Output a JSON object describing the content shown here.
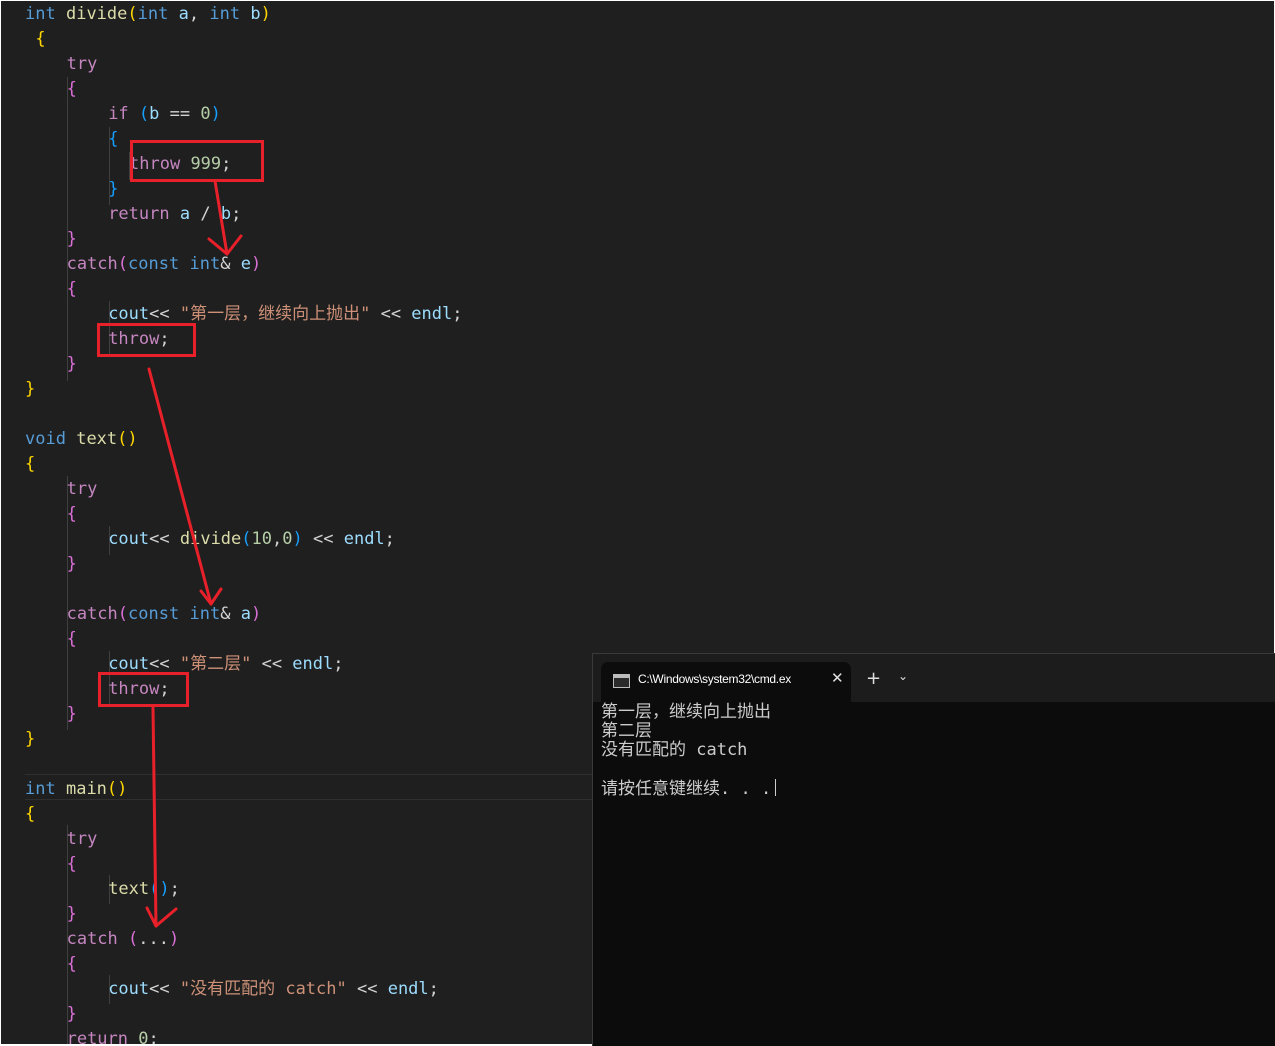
{
  "editor": {
    "lines": [
      {
        "indent": 0,
        "tokens": [
          {
            "t": "int",
            "c": "kw"
          },
          {
            "t": " "
          },
          {
            "t": "divide",
            "c": "fn"
          },
          {
            "t": "(",
            "c": "b1"
          },
          {
            "t": "int",
            "c": "kw"
          },
          {
            "t": " "
          },
          {
            "t": "a",
            "c": "var"
          },
          {
            "t": ", ",
            "c": "pl"
          },
          {
            "t": "int",
            "c": "kw"
          },
          {
            "t": " "
          },
          {
            "t": "b",
            "c": "var"
          },
          {
            "t": ")",
            "c": "b1"
          }
        ]
      },
      {
        "indent": 1,
        "tokens": [
          {
            "t": "{",
            "c": "b1"
          }
        ]
      },
      {
        "indent": 4,
        "tokens": [
          {
            "t": "try",
            "c": "ctl"
          }
        ]
      },
      {
        "indent": 4,
        "tokens": [
          {
            "t": "{",
            "c": "b2"
          }
        ]
      },
      {
        "indent": 8,
        "tokens": [
          {
            "t": "if",
            "c": "ctl"
          },
          {
            "t": " "
          },
          {
            "t": "(",
            "c": "b3"
          },
          {
            "t": "b",
            "c": "var"
          },
          {
            "t": " == ",
            "c": "pl"
          },
          {
            "t": "0",
            "c": "num"
          },
          {
            "t": ")",
            "c": "b3"
          }
        ]
      },
      {
        "indent": 8,
        "tokens": [
          {
            "t": "{",
            "c": "b3"
          }
        ]
      },
      {
        "indent": 10,
        "tokens": [
          {
            "t": "throw",
            "c": "ctl"
          },
          {
            "t": " "
          },
          {
            "t": "999",
            "c": "num"
          },
          {
            "t": ";",
            "c": "pl"
          }
        ]
      },
      {
        "indent": 8,
        "tokens": [
          {
            "t": "}",
            "c": "b3"
          }
        ]
      },
      {
        "indent": 8,
        "tokens": [
          {
            "t": "return",
            "c": "ctl"
          },
          {
            "t": " "
          },
          {
            "t": "a",
            "c": "var"
          },
          {
            "t": " / ",
            "c": "pl"
          },
          {
            "t": "b",
            "c": "var"
          },
          {
            "t": ";",
            "c": "pl"
          }
        ]
      },
      {
        "indent": 4,
        "tokens": [
          {
            "t": "}",
            "c": "b2"
          }
        ]
      },
      {
        "indent": 4,
        "tokens": [
          {
            "t": "catch",
            "c": "ctl"
          },
          {
            "t": "(",
            "c": "b2"
          },
          {
            "t": "const",
            "c": "kw"
          },
          {
            "t": " "
          },
          {
            "t": "int",
            "c": "kw"
          },
          {
            "t": "&",
            "c": "pl"
          },
          {
            "t": " "
          },
          {
            "t": "e",
            "c": "var"
          },
          {
            "t": ")",
            "c": "b2"
          }
        ]
      },
      {
        "indent": 4,
        "tokens": [
          {
            "t": "{",
            "c": "b2"
          }
        ]
      },
      {
        "indent": 8,
        "tokens": [
          {
            "t": "cout",
            "c": "var"
          },
          {
            "t": "<< ",
            "c": "pl"
          },
          {
            "t": "\"第一层，继续向上抛出\"",
            "c": "str"
          },
          {
            "t": " << ",
            "c": "pl"
          },
          {
            "t": "endl",
            "c": "var"
          },
          {
            "t": ";",
            "c": "pl"
          }
        ]
      },
      {
        "indent": 8,
        "tokens": [
          {
            "t": "throw",
            "c": "ctl"
          },
          {
            "t": ";",
            "c": "pl"
          }
        ]
      },
      {
        "indent": 4,
        "tokens": [
          {
            "t": "}",
            "c": "b2"
          }
        ]
      },
      {
        "indent": 0,
        "tokens": [
          {
            "t": "}",
            "c": "b1"
          }
        ]
      },
      {
        "indent": 0,
        "tokens": []
      },
      {
        "indent": 0,
        "tokens": [
          {
            "t": "void",
            "c": "kw"
          },
          {
            "t": " "
          },
          {
            "t": "text",
            "c": "fn"
          },
          {
            "t": "()",
            "c": "b1"
          }
        ]
      },
      {
        "indent": 0,
        "tokens": [
          {
            "t": "{",
            "c": "b1"
          }
        ]
      },
      {
        "indent": 4,
        "tokens": [
          {
            "t": "try",
            "c": "ctl"
          }
        ]
      },
      {
        "indent": 4,
        "tokens": [
          {
            "t": "{",
            "c": "b2"
          }
        ]
      },
      {
        "indent": 8,
        "tokens": [
          {
            "t": "cout",
            "c": "var"
          },
          {
            "t": "<< ",
            "c": "pl"
          },
          {
            "t": "divide",
            "c": "fn"
          },
          {
            "t": "(",
            "c": "b3"
          },
          {
            "t": "10",
            "c": "num"
          },
          {
            "t": ",",
            "c": "pl"
          },
          {
            "t": "0",
            "c": "num"
          },
          {
            "t": ")",
            "c": "b3"
          },
          {
            "t": " << ",
            "c": "pl"
          },
          {
            "t": "endl",
            "c": "var"
          },
          {
            "t": ";",
            "c": "pl"
          }
        ]
      },
      {
        "indent": 4,
        "tokens": [
          {
            "t": "}",
            "c": "b2"
          }
        ]
      },
      {
        "indent": 0,
        "tokens": []
      },
      {
        "indent": 4,
        "tokens": [
          {
            "t": "catch",
            "c": "ctl"
          },
          {
            "t": "(",
            "c": "b2"
          },
          {
            "t": "const",
            "c": "kw"
          },
          {
            "t": " "
          },
          {
            "t": "int",
            "c": "kw"
          },
          {
            "t": "&",
            "c": "pl"
          },
          {
            "t": " "
          },
          {
            "t": "a",
            "c": "var"
          },
          {
            "t": ")",
            "c": "b2"
          }
        ]
      },
      {
        "indent": 4,
        "tokens": [
          {
            "t": "{",
            "c": "b2"
          }
        ]
      },
      {
        "indent": 8,
        "tokens": [
          {
            "t": "cout",
            "c": "var"
          },
          {
            "t": "<< ",
            "c": "pl"
          },
          {
            "t": "\"第二层\"",
            "c": "str"
          },
          {
            "t": " << ",
            "c": "pl"
          },
          {
            "t": "endl",
            "c": "var"
          },
          {
            "t": ";",
            "c": "pl"
          }
        ]
      },
      {
        "indent": 8,
        "tokens": [
          {
            "t": "throw",
            "c": "ctl"
          },
          {
            "t": ";",
            "c": "pl"
          }
        ]
      },
      {
        "indent": 4,
        "tokens": [
          {
            "t": "}",
            "c": "b2"
          }
        ]
      },
      {
        "indent": 0,
        "tokens": [
          {
            "t": "}",
            "c": "b1"
          }
        ]
      },
      {
        "indent": 0,
        "tokens": []
      },
      {
        "indent": 0,
        "tokens": [
          {
            "t": "int",
            "c": "kw"
          },
          {
            "t": " "
          },
          {
            "t": "main",
            "c": "fn"
          },
          {
            "t": "()",
            "c": "b1"
          }
        ]
      },
      {
        "indent": 0,
        "tokens": [
          {
            "t": "{",
            "c": "b1"
          }
        ]
      },
      {
        "indent": 4,
        "tokens": [
          {
            "t": "try",
            "c": "ctl"
          }
        ]
      },
      {
        "indent": 4,
        "tokens": [
          {
            "t": "{",
            "c": "b2"
          }
        ]
      },
      {
        "indent": 8,
        "tokens": [
          {
            "t": "text",
            "c": "fn"
          },
          {
            "t": "()",
            "c": "b3"
          },
          {
            "t": ";",
            "c": "pl"
          }
        ]
      },
      {
        "indent": 4,
        "tokens": [
          {
            "t": "}",
            "c": "b2"
          }
        ]
      },
      {
        "indent": 4,
        "tokens": [
          {
            "t": "catch",
            "c": "ctl"
          },
          {
            "t": " "
          },
          {
            "t": "(",
            "c": "b2"
          },
          {
            "t": "...",
            "c": "pl"
          },
          {
            "t": ")",
            "c": "b2"
          }
        ]
      },
      {
        "indent": 4,
        "tokens": [
          {
            "t": "{",
            "c": "b2"
          }
        ]
      },
      {
        "indent": 8,
        "tokens": [
          {
            "t": "cout",
            "c": "var"
          },
          {
            "t": "<< ",
            "c": "pl"
          },
          {
            "t": "\"没有匹配的 catch\"",
            "c": "str"
          },
          {
            "t": " << ",
            "c": "pl"
          },
          {
            "t": "endl",
            "c": "var"
          },
          {
            "t": ";",
            "c": "pl"
          }
        ]
      },
      {
        "indent": 4,
        "tokens": [
          {
            "t": "}",
            "c": "b2"
          }
        ]
      },
      {
        "indent": 4,
        "tokens": [
          {
            "t": "return",
            "c": "ctl"
          },
          {
            "t": " "
          },
          {
            "t": "0",
            "c": "num"
          },
          {
            "t": ";",
            "c": "pl"
          }
        ]
      }
    ]
  },
  "terminal": {
    "tab_title": "C:\\Windows\\system32\\cmd.ex",
    "close_glyph": "✕",
    "new_tab_glyph": "+",
    "dropdown_glyph": "⌄",
    "output": [
      "第一层，继续向上抛出",
      "第二层",
      "没有匹配的 catch",
      "",
      "请按任意键继续. . ."
    ]
  },
  "colors": {
    "editor_bg": "#1f1f1f",
    "terminal_bg": "#0c0c0c",
    "annotation_red": "#e8202a",
    "keyword": "#569cd6",
    "control": "#c586c0",
    "function": "#dcdcaa",
    "variable": "#9cdcfe",
    "number": "#b5cea8",
    "string": "#ce9178"
  }
}
